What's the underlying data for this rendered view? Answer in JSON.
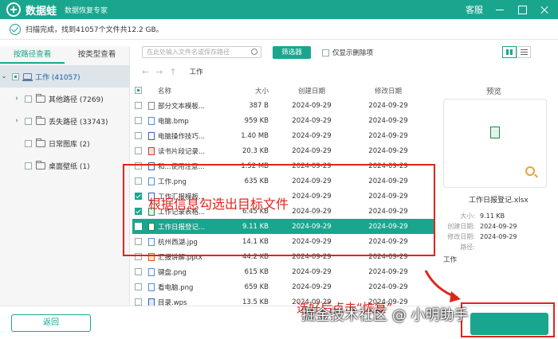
{
  "app": {
    "name": "数据蛙",
    "subtitle": "数据恢复专家",
    "service_label": "客服"
  },
  "status": {
    "text": "扫描完成，找到41057个文件共12.2 GB。"
  },
  "left_tabs": [
    {
      "label": "按路径查看",
      "active": true
    },
    {
      "label": "按类型查看",
      "active": false
    }
  ],
  "tree": [
    {
      "label": "工作 (41057)",
      "expanded": true,
      "checked": "partial",
      "icon": "drive-icon"
    },
    {
      "label": "其他路径 (7269)",
      "expanded": false,
      "checked": "none",
      "icon": "folder-icon"
    },
    {
      "label": "丢失路径 (33743)",
      "expanded": false,
      "checked": "none",
      "icon": "folder-icon"
    },
    {
      "label": "日常图库 (2)",
      "expanded": false,
      "checked": "none",
      "icon": "folder-icon"
    },
    {
      "label": "桌面壁纸 (1)",
      "expanded": false,
      "checked": "none",
      "icon": "folder-icon"
    }
  ],
  "toolbar": {
    "search_placeholder": "在此处输入文件名或保存路径",
    "filter_label": "筛选器",
    "only_deleted_label": "仅显示删除项"
  },
  "breadcrumb": {
    "path": "工作"
  },
  "table": {
    "headers": {
      "name": "名称",
      "size": "大小",
      "created": "创建日期",
      "modified": "修改日期"
    },
    "rows": [
      {
        "name": "部分文本模板...",
        "size": "387 B",
        "created": "2024-09-29",
        "modified": "2024-09-29",
        "type": "file",
        "checked": false,
        "selected": false
      },
      {
        "name": "电脑.bmp",
        "size": "959 KB",
        "created": "2024-09-29",
        "modified": "2024-09-29",
        "type": "img",
        "checked": false,
        "selected": false
      },
      {
        "name": "电脑操作技巧...",
        "size": "1.40 MB",
        "created": "2024-09-29",
        "modified": "2024-09-29",
        "type": "doc",
        "checked": false,
        "selected": false
      },
      {
        "name": "读书片段记录...",
        "size": "20.3 KB",
        "created": "2024-09-29",
        "modified": "2024-09-29",
        "type": "pdf",
        "checked": false,
        "selected": false
      },
      {
        "name": "和...使用注意...",
        "size": "1.52 MB",
        "created": "2024-09-29",
        "modified": "2024-09-29",
        "type": "doc",
        "checked": false,
        "selected": false
      },
      {
        "name": "工作.png",
        "size": "635 KB",
        "created": "2024-09-29",
        "modified": "2024-09-29",
        "type": "img",
        "checked": false,
        "selected": false
      },
      {
        "name": "工作汇报模板...",
        "size": "",
        "created": "2024-09-29",
        "modified": "2024-09-29",
        "type": "doc",
        "checked": true,
        "selected": false
      },
      {
        "name": "工作记录表格...",
        "size": "6.45 KB",
        "created": "2024-09-29",
        "modified": "2024-09-29",
        "type": "xls",
        "checked": true,
        "selected": false
      },
      {
        "name": "工作日报登记...",
        "size": "9.11 KB",
        "created": "2024-09-29",
        "modified": "2024-09-29",
        "type": "xls",
        "checked": true,
        "selected": true
      },
      {
        "name": "杭州西湖.jpg",
        "size": "14.1 KB",
        "created": "2024-09-29",
        "modified": "2024-09-29",
        "type": "img",
        "checked": false,
        "selected": false
      },
      {
        "name": "汇报讲解.pptx",
        "size": "44.2 KB",
        "created": "2024-09-29",
        "modified": "2024-09-29",
        "type": "ppt",
        "checked": false,
        "selected": false
      },
      {
        "name": "键盘.png",
        "size": "615 KB",
        "created": "2024-09-29",
        "modified": "2024-09-29",
        "type": "img",
        "checked": false,
        "selected": false
      },
      {
        "name": "看电脑.png",
        "size": "659 KB",
        "created": "2024-09-29",
        "modified": "2024-09-29",
        "type": "img",
        "checked": false,
        "selected": false
      },
      {
        "name": "目录.wps",
        "size": "13.5 KB",
        "created": "2024-09-29",
        "modified": "2024-09-29",
        "type": "wps",
        "checked": false,
        "selected": false
      }
    ]
  },
  "preview": {
    "title": "预览",
    "filename": "工作日报登记.xlsx",
    "meta": [
      {
        "k": "大小:",
        "v": "9.11 KB"
      },
      {
        "k": "创建日期:",
        "v": "2024-09-29"
      },
      {
        "k": "修改日期:",
        "v": "2024-09-29"
      },
      {
        "k": "路径:",
        "v": ""
      }
    ],
    "path_value": "工作"
  },
  "footer": {
    "back_label": "返回"
  },
  "annotations": {
    "box_text": "根据信息勾选出目标文件",
    "bottom_text": "选好后点击“恢复”",
    "watermark": "掘金技术社区 @ 小明助手"
  },
  "colors": {
    "accent": "#1aa68e",
    "annotation": "#e0241c"
  }
}
